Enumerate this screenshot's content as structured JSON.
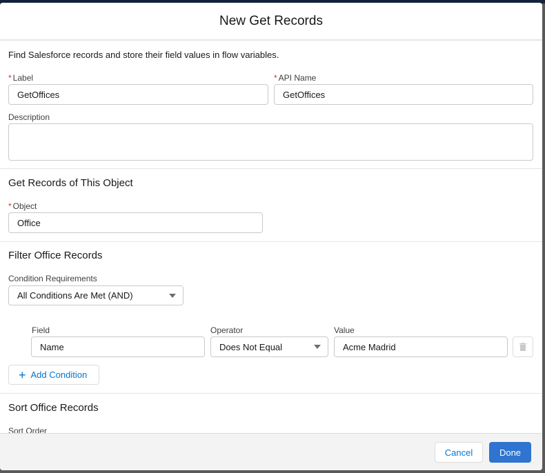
{
  "modal": {
    "title": "New Get Records",
    "intro": "Find Salesforce records and store their field values in flow variables."
  },
  "label": {
    "label": "Label",
    "value": "GetOffices",
    "required_mark": "*"
  },
  "api_name": {
    "label": "API Name",
    "value": "GetOffices",
    "required_mark": "*"
  },
  "description": {
    "label": "Description",
    "value": ""
  },
  "object_section": {
    "title": "Get Records of This Object",
    "object_label": "Object",
    "object_value": "Office",
    "required_mark": "*"
  },
  "filter_section": {
    "title": "Filter Office Records",
    "requirements_label": "Condition Requirements",
    "requirements_value": "All Conditions Are Met (AND)",
    "columns": {
      "field": "Field",
      "operator": "Operator",
      "value": "Value"
    },
    "conditions": [
      {
        "field": "Name",
        "operator": "Does Not Equal",
        "value": "Acme Madrid"
      }
    ],
    "add_condition": "Add Condition"
  },
  "sort_section": {
    "title": "Sort Office Records",
    "sort_order_label": "Sort Order"
  },
  "footer": {
    "cancel": "Cancel",
    "done": "Done"
  },
  "colors": {
    "brand": "#0176d3",
    "required": "#c23934"
  }
}
